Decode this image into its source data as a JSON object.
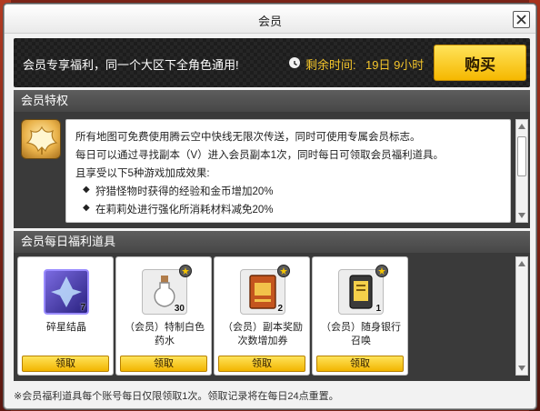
{
  "window": {
    "title": "会员"
  },
  "banner": {
    "text": "会员专享福利，同一个大区下全角色通用!",
    "remaining_label": "剩余时间:",
    "remaining_value": "19日 9小时",
    "buy_label": "购买"
  },
  "privileges": {
    "header": "会员特权",
    "lines": [
      "所有地图可免费使用腾云空中快线无限次传送，同时可使用专属会员标志。",
      "每日可以通过寻找副本（V）进入会员副本1次，同时每日可领取会员福利道具。",
      "且享受以下5种游戏加成效果:"
    ],
    "bullets": [
      "狩猎怪物时获得的经验和金币增加20%",
      "在莉莉处进行强化所消耗材料减免20%"
    ],
    "bullet_symbol": "◆"
  },
  "daily_items": {
    "header": "会员每日福利道具",
    "items": [
      {
        "name": "碎星结晶",
        "count": "7",
        "claim_label": "领取",
        "icon": "star-crystal-icon",
        "color": "#4a3aa8"
      },
      {
        "name": "（会员）特制白色药水",
        "count": "30",
        "claim_label": "领取",
        "icon": "white-potion-icon",
        "color": "#d8d8d8"
      },
      {
        "name": "（会员）副本奖励次数增加券",
        "count": "2",
        "claim_label": "领取",
        "icon": "ticket-icon",
        "color": "#c4551e"
      },
      {
        "name": "（会员）随身银行召唤",
        "count": "1",
        "claim_label": "领取",
        "icon": "bank-card-icon",
        "color": "#cfcfcf"
      }
    ]
  },
  "footer": {
    "note": "※会员福利道具每个账号每日仅限领取1次。领取记录将在每日24点重置。"
  },
  "colors": {
    "accent_yellow": "#f5b800",
    "remain_text": "#f3c42b"
  }
}
